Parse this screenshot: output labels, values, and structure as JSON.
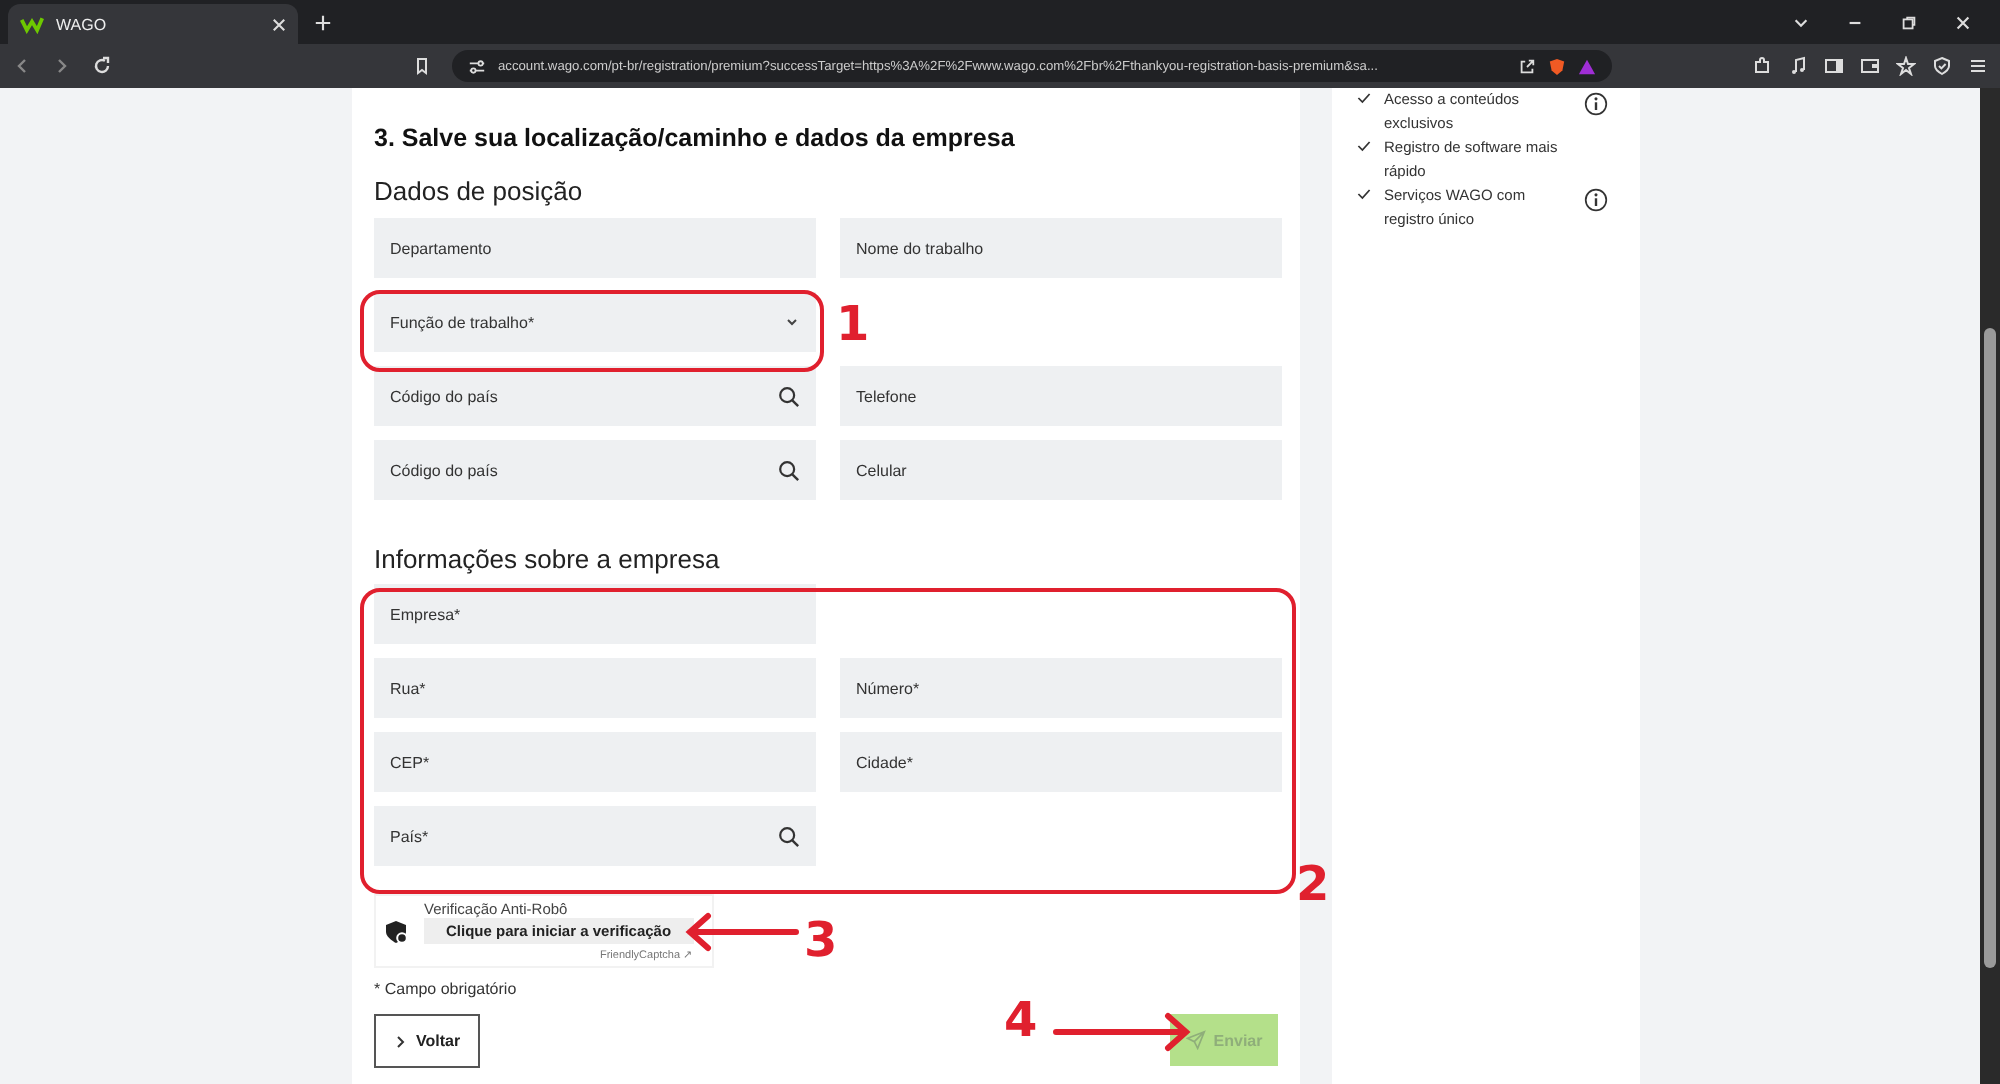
{
  "browser": {
    "tab_title": "WAGO",
    "url": "account.wago.com/pt-br/registration/premium?successTarget=https%3A%2F%2Fwww.wago.com%2Fbr%2Fthankyou-registration-basis-premium&sa..."
  },
  "form": {
    "heading": "3. Salve sua localização/caminho e dados da empresa",
    "sections": [
      {
        "title": "Dados de posição",
        "fields": [
          {
            "label": "Departamento",
            "kind": "text"
          },
          {
            "label": "Nome do trabalho",
            "kind": "text"
          },
          {
            "label": "Função de trabalho*",
            "kind": "select"
          },
          {
            "kind": "gap"
          },
          {
            "label": "Código do país",
            "kind": "search"
          },
          {
            "label": "Telefone",
            "kind": "text"
          },
          {
            "label": "Código do país",
            "kind": "search"
          },
          {
            "label": "Celular",
            "kind": "text"
          }
        ]
      },
      {
        "title": "Informações sobre a empresa",
        "fields": [
          {
            "label": "Empresa*",
            "kind": "text"
          },
          {
            "kind": "gap"
          },
          {
            "label": "Rua*",
            "kind": "text"
          },
          {
            "label": "Número*",
            "kind": "text"
          },
          {
            "label": "CEP*",
            "kind": "text"
          },
          {
            "label": "Cidade*",
            "kind": "text"
          },
          {
            "label": "País*",
            "kind": "search"
          },
          {
            "kind": "gap"
          }
        ]
      }
    ],
    "captcha": {
      "title": "Verificação Anti-Robô",
      "button": "Clique para iniciar a verificação",
      "footer": "FriendlyCaptcha ↗"
    },
    "required_note": "* Campo obrigatório",
    "back_button": "Voltar",
    "submit_button": {
      "label": "Enviar",
      "disabled": true
    }
  },
  "benefits": [
    {
      "text": "Acesso a conteúdos exclusivos",
      "info": true
    },
    {
      "text": "Registro de software mais rápido",
      "info": false
    },
    {
      "text": "Serviços WAGO com registro único",
      "info": true
    }
  ],
  "annotations": [
    {
      "label": "1"
    },
    {
      "label": "2"
    },
    {
      "label": "3"
    },
    {
      "label": "4"
    }
  ]
}
